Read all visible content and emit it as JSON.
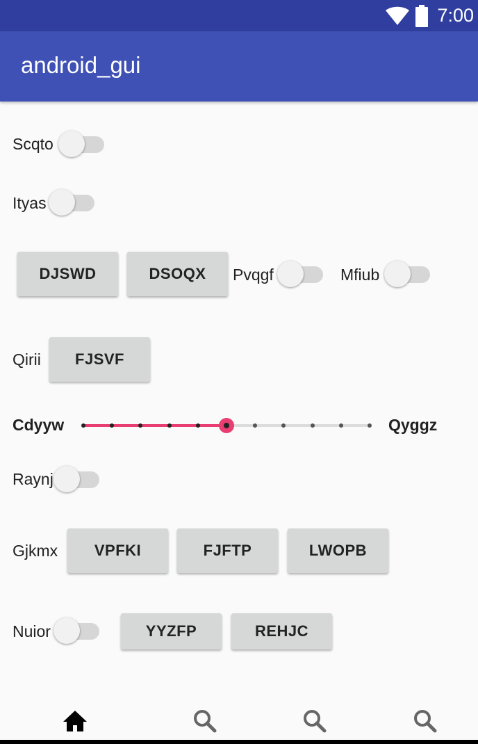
{
  "status_bar": {
    "time": "7:00",
    "icons": [
      "wifi-icon",
      "battery-icon"
    ]
  },
  "app_bar": {
    "title": "android_gui"
  },
  "rows": {
    "scqto": {
      "label": "Scqto",
      "checked": false
    },
    "ityas": {
      "label": "Ityas",
      "checked": false
    },
    "row3": {
      "buttons": [
        "DJSWD",
        "DSOQX"
      ],
      "pvqgf": {
        "label": "Pvqgf",
        "checked": false
      },
      "mfiub": {
        "label": "Mfiub",
        "checked": false
      }
    },
    "qirii": {
      "label": "Qirii",
      "button": "FJSVF"
    },
    "seekbar": {
      "start_label": "Cdyyw",
      "end_label": "Qyggz",
      "value": 5,
      "max": 10
    },
    "raynj": {
      "label": "Raynj",
      "checked": false
    },
    "gjkmx": {
      "label": "Gjkmx",
      "buttons": [
        "VPFKI",
        "FJFTP",
        "LWOPB"
      ]
    },
    "nuior": {
      "label": "Nuior",
      "checked": false,
      "buttons": [
        "YYZFP",
        "REHJC"
      ]
    }
  },
  "bottom_nav": {
    "items": [
      {
        "icon": "home-icon",
        "selected": true
      },
      {
        "icon": "search-icon",
        "selected": false
      },
      {
        "icon": "search-icon",
        "selected": false
      },
      {
        "icon": "search-icon",
        "selected": false
      }
    ]
  },
  "colors": {
    "status_bar": "#303f9f",
    "app_bar": "#3f51b5",
    "accent": "#e83e72",
    "background": "#fafafa",
    "button": "#d6d7d7"
  }
}
